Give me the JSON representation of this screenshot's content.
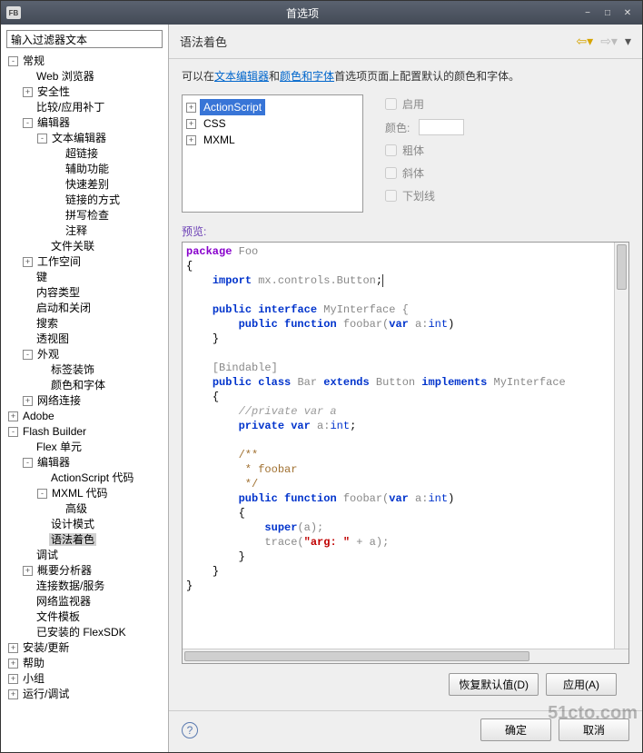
{
  "titlebar": {
    "icon": "FB",
    "title": "首选项"
  },
  "sidebar": {
    "filter_placeholder": "输入过滤器文本",
    "items": [
      {
        "label": "常规",
        "depth": 0,
        "toggle": "-"
      },
      {
        "label": "Web 浏览器",
        "depth": 1,
        "toggle": ""
      },
      {
        "label": "安全性",
        "depth": 1,
        "toggle": "+"
      },
      {
        "label": "比较/应用补丁",
        "depth": 1,
        "toggle": ""
      },
      {
        "label": "编辑器",
        "depth": 1,
        "toggle": "-"
      },
      {
        "label": "文本编辑器",
        "depth": 2,
        "toggle": "-"
      },
      {
        "label": "超链接",
        "depth": 3,
        "toggle": ""
      },
      {
        "label": "辅助功能",
        "depth": 3,
        "toggle": ""
      },
      {
        "label": "快速差别",
        "depth": 3,
        "toggle": ""
      },
      {
        "label": "链接的方式",
        "depth": 3,
        "toggle": ""
      },
      {
        "label": "拼写检查",
        "depth": 3,
        "toggle": ""
      },
      {
        "label": "注释",
        "depth": 3,
        "toggle": ""
      },
      {
        "label": "文件关联",
        "depth": 2,
        "toggle": ""
      },
      {
        "label": "工作空间",
        "depth": 1,
        "toggle": "+"
      },
      {
        "label": "键",
        "depth": 1,
        "toggle": ""
      },
      {
        "label": "内容类型",
        "depth": 1,
        "toggle": ""
      },
      {
        "label": "启动和关闭",
        "depth": 1,
        "toggle": ""
      },
      {
        "label": "搜索",
        "depth": 1,
        "toggle": ""
      },
      {
        "label": "透视图",
        "depth": 1,
        "toggle": ""
      },
      {
        "label": "外观",
        "depth": 1,
        "toggle": "-"
      },
      {
        "label": "标签装饰",
        "depth": 2,
        "toggle": ""
      },
      {
        "label": "颜色和字体",
        "depth": 2,
        "toggle": ""
      },
      {
        "label": "网络连接",
        "depth": 1,
        "toggle": "+"
      },
      {
        "label": "Adobe",
        "depth": 0,
        "toggle": "+"
      },
      {
        "label": "Flash Builder",
        "depth": 0,
        "toggle": "-"
      },
      {
        "label": "Flex 单元",
        "depth": 1,
        "toggle": ""
      },
      {
        "label": "编辑器",
        "depth": 1,
        "toggle": "-"
      },
      {
        "label": "ActionScript 代码",
        "depth": 2,
        "toggle": ""
      },
      {
        "label": "MXML 代码",
        "depth": 2,
        "toggle": "-"
      },
      {
        "label": "高级",
        "depth": 3,
        "toggle": ""
      },
      {
        "label": "设计模式",
        "depth": 2,
        "toggle": ""
      },
      {
        "label": "语法着色",
        "depth": 2,
        "toggle": "",
        "selected": true
      },
      {
        "label": "调试",
        "depth": 1,
        "toggle": ""
      },
      {
        "label": "概要分析器",
        "depth": 1,
        "toggle": "+"
      },
      {
        "label": "连接数据/服务",
        "depth": 1,
        "toggle": ""
      },
      {
        "label": "网络监视器",
        "depth": 1,
        "toggle": ""
      },
      {
        "label": "文件模板",
        "depth": 1,
        "toggle": ""
      },
      {
        "label": "已安装的 FlexSDK",
        "depth": 1,
        "toggle": ""
      },
      {
        "label": "安装/更新",
        "depth": 0,
        "toggle": "+"
      },
      {
        "label": "帮助",
        "depth": 0,
        "toggle": "+"
      },
      {
        "label": "小组",
        "depth": 0,
        "toggle": "+"
      },
      {
        "label": "运行/调试",
        "depth": 0,
        "toggle": "+"
      }
    ]
  },
  "main": {
    "title": "语法着色",
    "desc_prefix": "可以在",
    "link1": "文本编辑器",
    "desc_mid": "和",
    "link2": "颜色和字体",
    "desc_suffix": "首选项页面上配置默认的颜色和字体。",
    "langs": [
      {
        "label": "ActionScript",
        "selected": true
      },
      {
        "label": "CSS"
      },
      {
        "label": "MXML"
      }
    ],
    "opts": {
      "enable": "启用",
      "color": "颜色:",
      "bold": "粗体",
      "italic": "斜体",
      "underline": "下划线"
    },
    "preview_label": "预览:",
    "code": {
      "l1a": "package",
      "l1b": " Foo",
      "l2": "{",
      "l3a": "import",
      "l3b": " mx.controls.Button",
      "l4a": "public",
      "l4b": "interface",
      "l4c": " MyInterface {",
      "l5a": "public",
      "l5b": "function",
      "l5c": " foobar(",
      "l5d": "var",
      "l5e": " a:",
      "l5f": "int",
      "l5g": ")",
      "l6": "}",
      "l7": "[Bindable]",
      "l8a": "public",
      "l8b": "class",
      "l8c": " Bar ",
      "l8d": "extends",
      "l8e": " Button ",
      "l8f": "implements",
      "l8g": " MyInterface",
      "l9": "{",
      "l10": "//private var a",
      "l11a": "private",
      "l11b": "var",
      "l11c": " a:",
      "l11d": "int",
      "l12a": "/**",
      "l12b": " * foobar",
      "l12c": " */",
      "l13a": "public",
      "l13b": "function",
      "l13c": " foobar(",
      "l13d": "var",
      "l13e": " a:",
      "l13f": "int",
      "l13g": ")",
      "l14": "{",
      "l15a": "super",
      "l15b": "(a);",
      "l16a": "trace(",
      "l16b": "\"arg: \"",
      "l16c": " + a);",
      "l17": "}",
      "l18": "}",
      "l19": "}"
    }
  },
  "buttons": {
    "restore": "恢复默认值(D)",
    "apply": "应用(A)",
    "ok": "确定",
    "cancel": "取消"
  },
  "watermark": "51cto.com"
}
